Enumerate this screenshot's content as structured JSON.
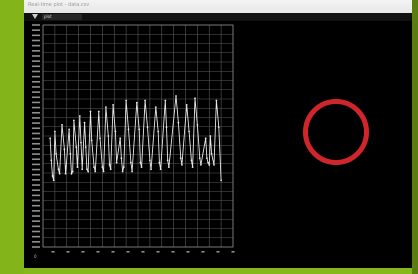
{
  "window": {
    "title": "Real-time plot - data.csv"
  },
  "toolbar": {
    "tab_label": "plot"
  },
  "chart": {
    "corner_label": "0",
    "grid": true,
    "trace_color": "#e8e8e8",
    "grid_color": "#5a5a5a",
    "y_tick_count": 44,
    "x_tick_count": 13
  },
  "chart_data": {
    "type": "line",
    "title": "",
    "xlabel": "",
    "ylabel": "",
    "xlim": [
      0,
      160
    ],
    "ylim": [
      0,
      100
    ],
    "grid": true,
    "series": [
      {
        "values": [
          [
            6,
            49
          ],
          [
            7,
            39
          ],
          [
            8,
            32
          ],
          [
            9,
            30
          ],
          [
            10,
            52
          ],
          [
            11,
            42
          ],
          [
            13,
            35
          ],
          [
            14,
            33
          ],
          [
            16,
            55
          ],
          [
            18,
            44
          ],
          [
            19,
            33
          ],
          [
            22,
            53
          ],
          [
            23,
            42
          ],
          [
            24,
            33
          ],
          [
            25,
            34
          ],
          [
            26,
            57
          ],
          [
            28,
            45
          ],
          [
            29,
            36
          ],
          [
            31,
            59
          ],
          [
            32,
            47
          ],
          [
            33,
            35
          ],
          [
            35,
            56
          ],
          [
            36,
            45
          ],
          [
            37,
            35
          ],
          [
            38,
            34
          ],
          [
            40,
            61
          ],
          [
            41,
            48
          ],
          [
            43,
            36
          ],
          [
            44,
            34
          ],
          [
            47,
            61
          ],
          [
            48,
            49
          ],
          [
            50,
            36
          ],
          [
            51,
            34
          ],
          [
            53,
            63
          ],
          [
            55,
            50
          ],
          [
            56,
            37
          ],
          [
            57,
            35
          ],
          [
            59,
            64
          ],
          [
            61,
            52
          ],
          [
            62,
            38
          ],
          [
            65,
            49
          ],
          [
            66,
            40
          ],
          [
            67,
            34
          ],
          [
            68,
            36
          ],
          [
            70,
            66
          ],
          [
            72,
            53
          ],
          [
            74,
            38
          ],
          [
            75,
            34
          ],
          [
            79,
            65
          ],
          [
            81,
            53
          ],
          [
            82,
            38
          ],
          [
            83,
            36
          ],
          [
            86,
            66
          ],
          [
            88,
            54
          ],
          [
            90,
            39
          ],
          [
            91,
            35
          ],
          [
            95,
            63
          ],
          [
            97,
            52
          ],
          [
            98,
            38
          ],
          [
            99,
            35
          ],
          [
            103,
            66
          ],
          [
            104,
            54
          ],
          [
            105,
            39
          ],
          [
            106,
            36
          ],
          [
            112,
            68
          ],
          [
            114,
            56
          ],
          [
            116,
            40
          ],
          [
            117,
            37
          ],
          [
            121,
            64
          ],
          [
            123,
            52
          ],
          [
            125,
            39
          ],
          [
            126,
            36
          ],
          [
            128,
            67
          ],
          [
            130,
            55
          ],
          [
            132,
            40
          ],
          [
            133,
            37
          ],
          [
            137,
            49
          ],
          [
            138,
            40
          ],
          [
            139,
            38
          ],
          [
            140,
            37
          ],
          [
            141,
            50
          ],
          [
            142,
            42
          ],
          [
            144,
            37
          ],
          [
            146,
            66
          ],
          [
            148,
            54
          ],
          [
            150,
            30
          ]
        ]
      }
    ]
  }
}
